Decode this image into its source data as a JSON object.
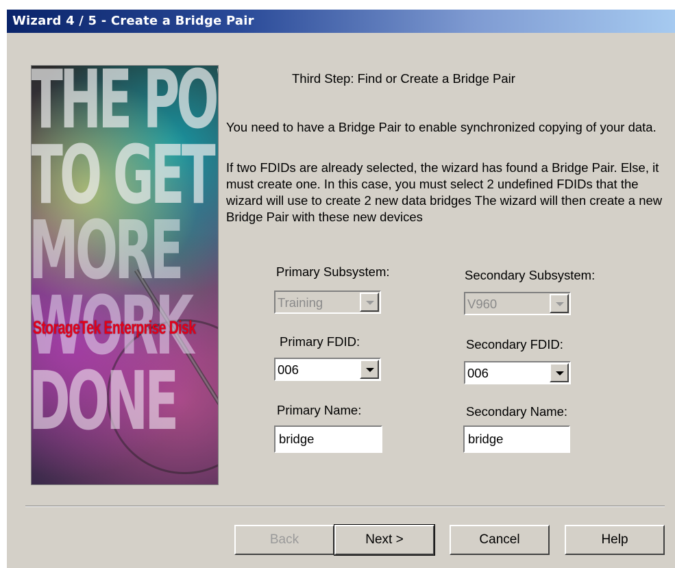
{
  "window": {
    "title": "Wizard 4 / 5 - Create a Bridge Pair"
  },
  "banner": {
    "lines": [
      "THE POWER",
      "TO GET",
      "MORE",
      "WORK",
      "DONE"
    ],
    "brand": "StorageTek Enterprise Disk"
  },
  "content": {
    "step_heading": "Third Step: Find or Create a Bridge Pair",
    "paragraph1": "You need to have a Bridge Pair to enable synchronized copying of your data.",
    "paragraph2": "If two FDIDs are already selected, the wizard has found a Bridge Pair. Else, it must create one. In this case, you must select 2 undefined FDIDs that the wizard will use to create 2 new data bridges The wizard will then create a new Bridge Pair with these new devices"
  },
  "form": {
    "primary_subsystem_label": "Primary Subsystem:",
    "primary_subsystem_value": "Training",
    "secondary_subsystem_label": "Secondary Subsystem:",
    "secondary_subsystem_value": "V960",
    "primary_fdid_label": "Primary FDID:",
    "primary_fdid_value": "006",
    "secondary_fdid_label": "Secondary FDID:",
    "secondary_fdid_value": "006",
    "primary_name_label": "Primary Name:",
    "primary_name_value": "bridge",
    "secondary_name_label": "Secondary Name:",
    "secondary_name_value": "bridge"
  },
  "buttons": {
    "back": "Back",
    "next": "Next >",
    "cancel": "Cancel",
    "help": "Help"
  },
  "colors": {
    "title_bar_start": "#0a246a",
    "title_bar_end": "#a6caf0",
    "dialog_background": "#d4d0c8",
    "brand_red": "#e1001a"
  }
}
